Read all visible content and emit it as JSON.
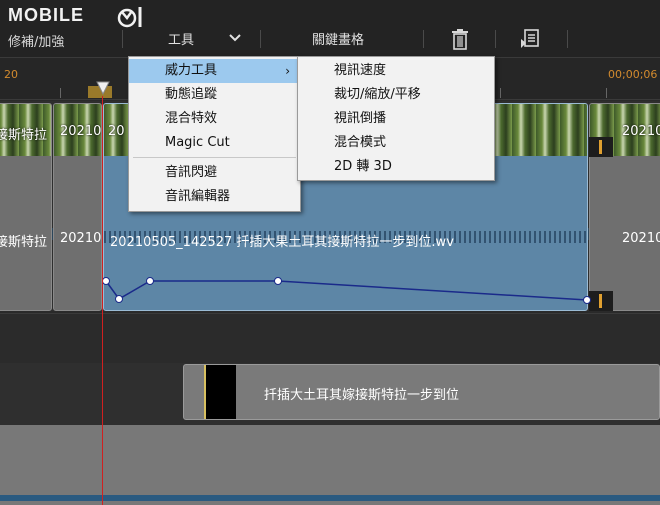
{
  "brand": {
    "logo_text": "MOBILE"
  },
  "toolbar": {
    "fix_enhance": "修補/加強",
    "tools": "工具",
    "keyframe": "關鍵畫格"
  },
  "ruler": {
    "left_time": "20",
    "right_time": "00;00;06"
  },
  "video_clips": [
    {
      "label": "接斯特拉",
      "label2": "接斯特拉"
    },
    {
      "label": "20210",
      "label2": "20210"
    },
    {
      "label": "20",
      "label2": "20210505_142527 扦插大果土耳其接斯特拉一步到位.wv"
    },
    {
      "label": "20210",
      "label2": "20210"
    }
  ],
  "text_clip": {
    "label": "扦插大土耳其嫁接斯特拉一步到位"
  },
  "tools_menu": {
    "items": [
      "威力工具",
      "動態追蹤",
      "混合特效",
      "Magic Cut",
      "音訊閃避",
      "音訊編輯器"
    ],
    "highlighted": "威力工具"
  },
  "power_tools_submenu": {
    "items": [
      "視訊速度",
      "裁切/縮放/平移",
      "視訊倒播",
      "混合模式",
      "2D 轉 3D"
    ]
  },
  "icons": {
    "tools_dropdown": "chevron-down-icon",
    "trash": "trash-icon",
    "export": "export-icon",
    "submenu_arrow": "chevron-right-icon"
  },
  "colors": {
    "selected_clip": "#5d86a6",
    "playhead": "#d02020",
    "menu_highlight": "#9cc9ee",
    "ruler_text": "#d28a2e"
  }
}
